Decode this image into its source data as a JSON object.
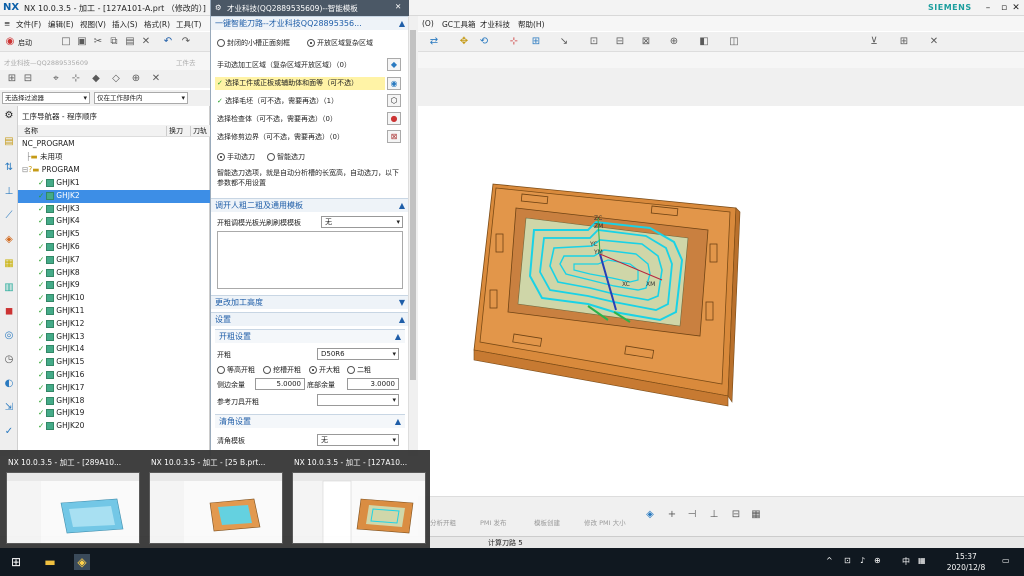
{
  "window": {
    "title": "NX 10.0.3.5 - 加工 - [127A101-A.prt （修改的）]",
    "brand": "SIEMENS",
    "logo": "NX"
  },
  "menu": [
    "文件(F)",
    "编辑(E)",
    "视图(V)",
    "插入(S)",
    "格式(R)",
    "工具(T)"
  ],
  "right_menu": [
    "(O)",
    "GC工具箱",
    "才业科技",
    "帮助(H)"
  ],
  "toolbar": {
    "start_label": "启动",
    "watermark_text": "才业科技—QQ2889535609",
    "work_part_label": "工件去"
  },
  "filters": {
    "type_filter": "无选择过滤器",
    "scope_filter": "仅在工作部件内"
  },
  "navigator": {
    "title": "工序导航器 - 程序顺序",
    "columns": [
      "名称",
      "换刀",
      "刀轨"
    ],
    "root": "NC_PROGRAM",
    "unused": "未用项",
    "program": "PROGRAM",
    "selected_index": 1,
    "operations": [
      "GHJK1",
      "GHJK2",
      "GHJK3",
      "GHJK4",
      "GHJK5",
      "GHJK6",
      "GHJK7",
      "GHJK8",
      "GHJK9",
      "GHJK10",
      "GHJK11",
      "GHJK12",
      "GHJK13",
      "GHJK14",
      "GHJK15",
      "GHJK16",
      "GHJK17",
      "GHJK18",
      "GHJK19",
      "GHJK20"
    ]
  },
  "dialog": {
    "title": "才业科技(QQ2889535609)--智能模板",
    "section1": "一键智能刀路--才业科技QQ28895356...",
    "radio_closed": "封闭的小槽正面刻框",
    "radio_open": "开放区域复杂区域",
    "row_manual": "手动选加工区域（复杂区域开放区域）（0）",
    "row_select_workpiece": "选择工件或正板或辅助体和面等（可不选）",
    "row_select_blank": "选择毛坯（可不选，需要再选）（1）",
    "row_check_body": "选择检查体（可不选，需要再选）（0）",
    "row_trim_boundary": "选择修剪边界（可不选，需要再选）（0）",
    "radio_manual_tool": "手动选刀",
    "radio_smart_tool": "智能选刀",
    "hint": "智能选刀选项，就是自动分析槽的长宽高，自动选刀，以下参数都不用设置",
    "section2": "调开人粗二粗及通用模板",
    "template_label": "开粗调模光板光刷刷模模板",
    "template_value": "无",
    "section3": "更改加工高度",
    "section4": "设置",
    "sub_rough": "开粗设置",
    "rough_label": "开粗",
    "rough_tool": "D50R6",
    "opt_equal": "等高开粗",
    "opt_slot": "挖槽开粗",
    "opt_big": "开大粗",
    "opt_second": "二粗",
    "side_stock_label": "侧边余量",
    "side_stock": "5.0000",
    "floor_stock_label": "底部余量",
    "floor_stock": "3.0000",
    "ref_tool_label": "参考刀具开粗",
    "sub_finish": "清角设置",
    "finish_label": "清角模板",
    "finish_value": "无"
  },
  "status": {
    "compute": "计算刀路 5"
  },
  "bottom_tools": [
    "分析开粗",
    "PMI 发布",
    "模板创建",
    "修改 PMI 大小"
  ],
  "viewport_labels": [
    "XC",
    "XM",
    "YC",
    "YM",
    "ZC",
    "ZM"
  ],
  "taskbar": {
    "thumbnails": [
      "NX 10.0.3.5 - 加工 - [289A10...",
      "NX 10.0.3.5 - 加工 - [25 B.prt...",
      "NX 10.0.3.5 - 加工 - [127A10..."
    ],
    "time": "15:37",
    "date": "2020/12/8",
    "ime": "中"
  }
}
